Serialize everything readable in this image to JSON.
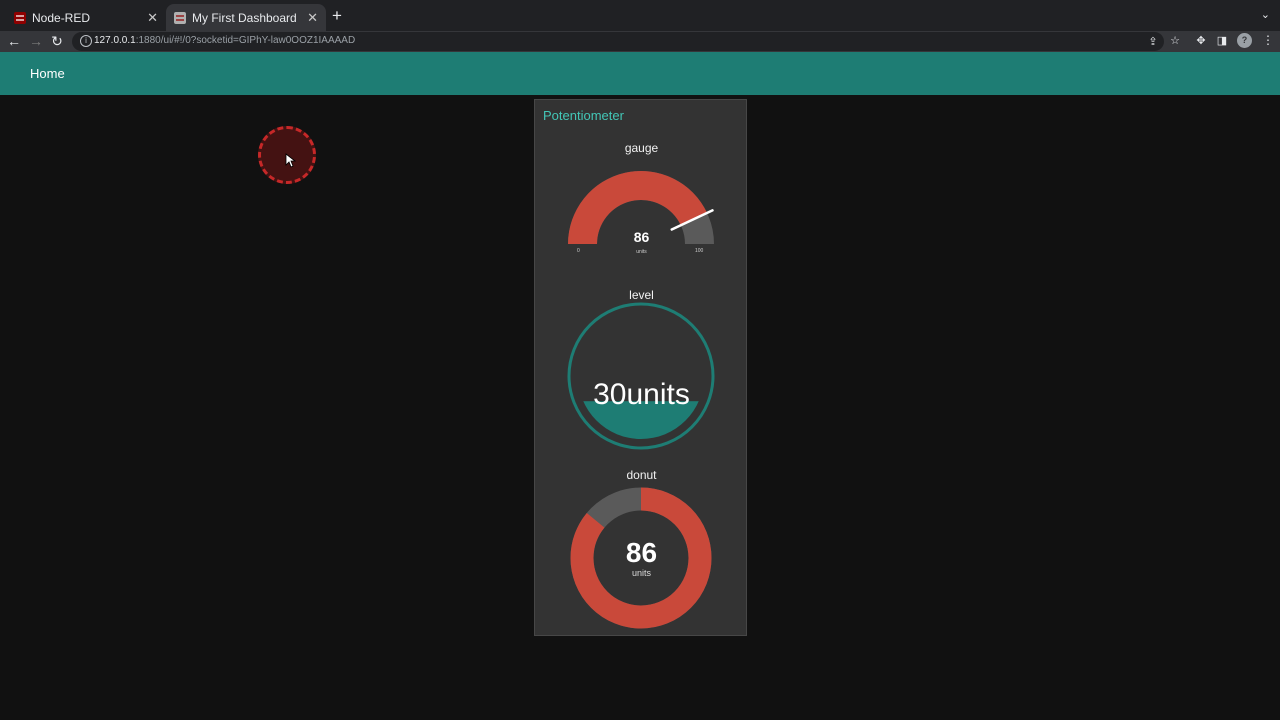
{
  "browser": {
    "tabs": [
      {
        "label": "Node-RED",
        "active": false
      },
      {
        "label": "My First Dashboard",
        "active": true
      }
    ],
    "url_host": "127.0.0.1",
    "url_rest": ":1880/ui/#!/0?socketid=GIPhY-law0OOZ1IAAAAD",
    "new_tab": "+",
    "profile_initial": "?"
  },
  "app": {
    "header_title": "Home"
  },
  "card": {
    "title": "Potentiometer",
    "gauge": {
      "label": "gauge",
      "value": "86",
      "units": "units",
      "min": "0",
      "max": "100",
      "fraction": 0.86,
      "color": "#c9493a"
    },
    "level": {
      "label": "level",
      "value_text": "30units",
      "fraction": 0.3,
      "color": "#1e7d74"
    },
    "donut": {
      "label": "donut",
      "value": "86",
      "units": "units",
      "fraction": 0.86,
      "color": "#c9493a"
    }
  },
  "colors": {
    "accent": "#1e7d74",
    "title_accent": "#43c6b6",
    "track": "#5a5a5a",
    "card_bg": "#333333"
  }
}
